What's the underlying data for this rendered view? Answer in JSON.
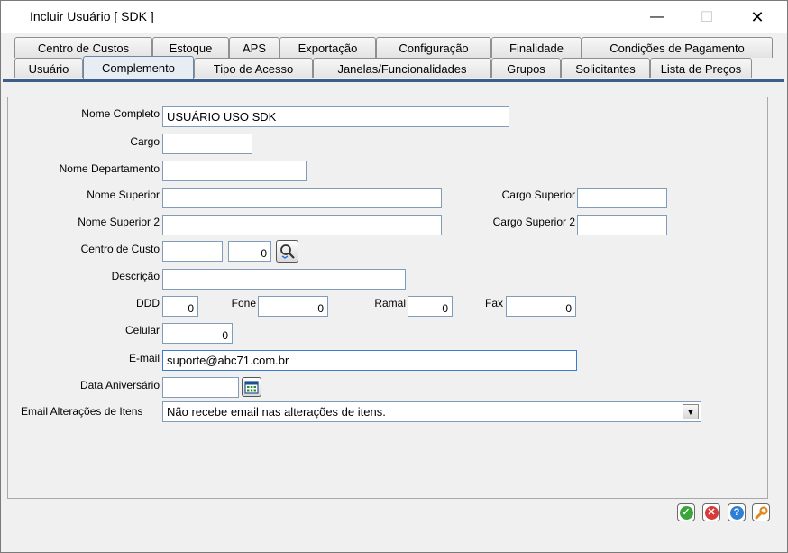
{
  "window": {
    "title": "Incluir Usuário [ SDK ]"
  },
  "tabs_row1": [
    "Centro de Custos",
    "Estoque",
    "APS",
    "Exportação",
    "Configuração",
    "Finalidade",
    "Condições de Pagamento"
  ],
  "tabs_row2": [
    "Usuário",
    "Complemento",
    "Tipo de Acesso",
    "Janelas/Funcionalidades",
    "Grupos",
    "Solicitantes",
    "Lista de Preços"
  ],
  "active_tab": "Complemento",
  "form": {
    "nome_completo": {
      "label": "Nome Completo",
      "value": "USUÁRIO USO SDK"
    },
    "cargo": {
      "label": "Cargo",
      "value": ""
    },
    "nome_departamento": {
      "label": "Nome Departamento",
      "value": ""
    },
    "nome_superior": {
      "label": "Nome Superior",
      "value": ""
    },
    "cargo_superior": {
      "label": "Cargo Superior",
      "value": ""
    },
    "nome_superior2": {
      "label": "Nome Superior 2",
      "value": ""
    },
    "cargo_superior2": {
      "label": "Cargo Superior 2",
      "value": ""
    },
    "centro_custo": {
      "label": "Centro de Custo",
      "code": "",
      "number": "0"
    },
    "descricao": {
      "label": "Descrição",
      "value": ""
    },
    "ddd": {
      "label": "DDD",
      "value": "0"
    },
    "fone": {
      "label": "Fone",
      "value": "0"
    },
    "ramal": {
      "label": "Ramal",
      "value": "0"
    },
    "fax": {
      "label": "Fax",
      "value": "0"
    },
    "celular": {
      "label": "Celular",
      "value": "0"
    },
    "email": {
      "label": "E-mail",
      "value": "suporte@abc71.com.br"
    },
    "data_aniversario": {
      "label": "Data Aniversário",
      "value": ""
    },
    "email_alteracoes": {
      "label": "Email Alterações de Itens",
      "selected": "Não recebe email nas alterações de itens."
    }
  },
  "colors": {
    "tab_line": "#3c5f8a",
    "ok": "#3aa63a",
    "cancel": "#d63a3a",
    "help": "#2f7fd6",
    "tools": "#e08a1e"
  }
}
